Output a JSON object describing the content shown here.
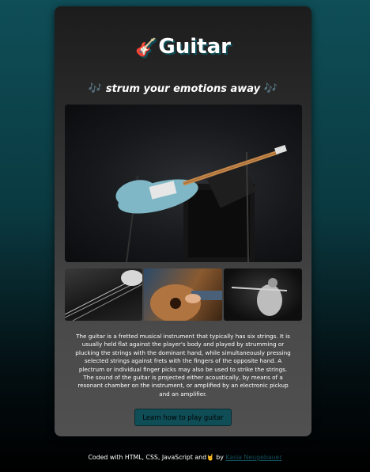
{
  "header": {
    "title": "Guitar",
    "title_emoji": "🎸",
    "subtitle": "strum your emotions away",
    "subtitle_note_left": "🎶",
    "subtitle_note_right": "🎶"
  },
  "gallery": {
    "main_image": "guitar-on-amplifier-photo",
    "thumbnails": [
      "guitar-strings-closeup-photo",
      "acoustic-guitar-player-photo",
      "guitarist-performing-photo"
    ]
  },
  "description": "The guitar is a fretted musical instrument that typically has six strings. It is usually held flat against the player's body and played by strumming or plucking the strings with the dominant hand, while simultaneously pressing selected strings against frets with the fingers of the opposite hand. A plectrum or individual finger picks may also be used to strike the strings. The sound of the guitar is projected either acoustically, by means of a resonant chamber on the instrument, or amplified by an electronic pickup and an amplifier.",
  "cta": {
    "label": "Learn how to play guitar"
  },
  "footer": {
    "text": "Coded with HTML, CSS, JavaScript and",
    "emoji": "🤘",
    "by": "by",
    "author": "Kasia Neugebauer"
  },
  "colors": {
    "accent": "#0f4e57",
    "card": "#3a3a3a",
    "text": "#ffffff"
  }
}
